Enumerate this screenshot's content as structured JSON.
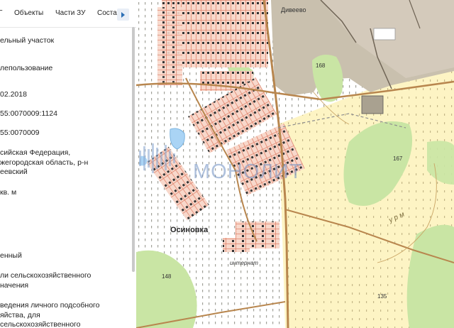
{
  "tabs": [
    "Объекты",
    "Части ЗУ",
    "Соста",
    "Г"
  ],
  "fields": [
    {
      "value": "ельный участок"
    },
    {
      "value": "лепользование"
    },
    {
      "value": "02.2018"
    },
    {
      "value": "55:0070009:1124"
    },
    {
      "value": "55:0070009"
    },
    {
      "value": "сийская Федерация,\nжегородская область, р-н\nеевский"
    },
    {
      "value": "кв. м"
    },
    {
      "value": "енный"
    },
    {
      "value": "ли сельскохозяйственного\nначения"
    },
    {
      "value": "ведения личного подсобного\nяйства, для\nсельскохозяйственного"
    }
  ],
  "map": {
    "place_labels": {
      "diveevo": "Дивеево",
      "osinovka": "Осиновка",
      "internat": "интернат",
      "ury": "у р м"
    },
    "elevations": [
      "168",
      "167",
      "148",
      "135"
    ],
    "watermark": "МОНОЛИТ",
    "colors": {
      "agri": "#fdf4c4",
      "forest": "#c9e5a4",
      "builtup": "#c9c0ae",
      "parcel": "#f8d8cb",
      "parcel_line": "#e0826a",
      "road": "#b8864e",
      "water": "#aad4f5"
    }
  }
}
